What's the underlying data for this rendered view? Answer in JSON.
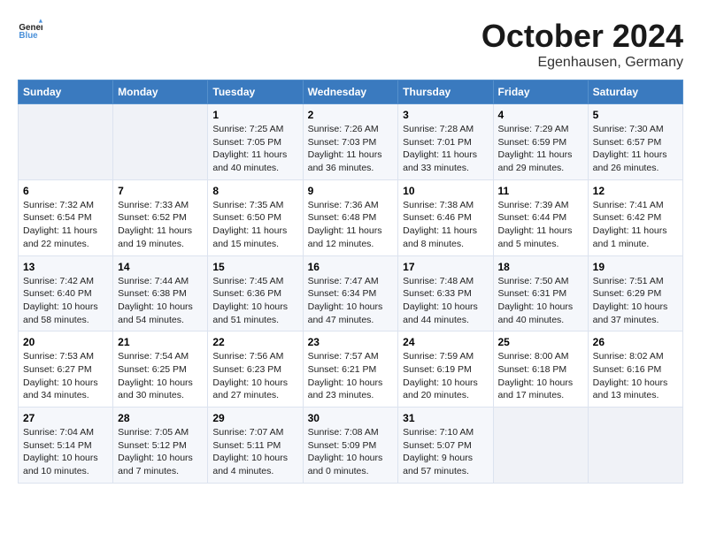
{
  "header": {
    "logo_text_general": "General",
    "logo_text_blue": "Blue",
    "month_title": "October 2024",
    "location": "Egenhausen, Germany"
  },
  "weekdays": [
    "Sunday",
    "Monday",
    "Tuesday",
    "Wednesday",
    "Thursday",
    "Friday",
    "Saturday"
  ],
  "weeks": [
    [
      {
        "day": "",
        "empty": true
      },
      {
        "day": "",
        "empty": true
      },
      {
        "day": "1",
        "sunrise": "Sunrise: 7:25 AM",
        "sunset": "Sunset: 7:05 PM",
        "daylight": "Daylight: 11 hours and 40 minutes."
      },
      {
        "day": "2",
        "sunrise": "Sunrise: 7:26 AM",
        "sunset": "Sunset: 7:03 PM",
        "daylight": "Daylight: 11 hours and 36 minutes."
      },
      {
        "day": "3",
        "sunrise": "Sunrise: 7:28 AM",
        "sunset": "Sunset: 7:01 PM",
        "daylight": "Daylight: 11 hours and 33 minutes."
      },
      {
        "day": "4",
        "sunrise": "Sunrise: 7:29 AM",
        "sunset": "Sunset: 6:59 PM",
        "daylight": "Daylight: 11 hours and 29 minutes."
      },
      {
        "day": "5",
        "sunrise": "Sunrise: 7:30 AM",
        "sunset": "Sunset: 6:57 PM",
        "daylight": "Daylight: 11 hours and 26 minutes."
      }
    ],
    [
      {
        "day": "6",
        "sunrise": "Sunrise: 7:32 AM",
        "sunset": "Sunset: 6:54 PM",
        "daylight": "Daylight: 11 hours and 22 minutes."
      },
      {
        "day": "7",
        "sunrise": "Sunrise: 7:33 AM",
        "sunset": "Sunset: 6:52 PM",
        "daylight": "Daylight: 11 hours and 19 minutes."
      },
      {
        "day": "8",
        "sunrise": "Sunrise: 7:35 AM",
        "sunset": "Sunset: 6:50 PM",
        "daylight": "Daylight: 11 hours and 15 minutes."
      },
      {
        "day": "9",
        "sunrise": "Sunrise: 7:36 AM",
        "sunset": "Sunset: 6:48 PM",
        "daylight": "Daylight: 11 hours and 12 minutes."
      },
      {
        "day": "10",
        "sunrise": "Sunrise: 7:38 AM",
        "sunset": "Sunset: 6:46 PM",
        "daylight": "Daylight: 11 hours and 8 minutes."
      },
      {
        "day": "11",
        "sunrise": "Sunrise: 7:39 AM",
        "sunset": "Sunset: 6:44 PM",
        "daylight": "Daylight: 11 hours and 5 minutes."
      },
      {
        "day": "12",
        "sunrise": "Sunrise: 7:41 AM",
        "sunset": "Sunset: 6:42 PM",
        "daylight": "Daylight: 11 hours and 1 minute."
      }
    ],
    [
      {
        "day": "13",
        "sunrise": "Sunrise: 7:42 AM",
        "sunset": "Sunset: 6:40 PM",
        "daylight": "Daylight: 10 hours and 58 minutes."
      },
      {
        "day": "14",
        "sunrise": "Sunrise: 7:44 AM",
        "sunset": "Sunset: 6:38 PM",
        "daylight": "Daylight: 10 hours and 54 minutes."
      },
      {
        "day": "15",
        "sunrise": "Sunrise: 7:45 AM",
        "sunset": "Sunset: 6:36 PM",
        "daylight": "Daylight: 10 hours and 51 minutes."
      },
      {
        "day": "16",
        "sunrise": "Sunrise: 7:47 AM",
        "sunset": "Sunset: 6:34 PM",
        "daylight": "Daylight: 10 hours and 47 minutes."
      },
      {
        "day": "17",
        "sunrise": "Sunrise: 7:48 AM",
        "sunset": "Sunset: 6:33 PM",
        "daylight": "Daylight: 10 hours and 44 minutes."
      },
      {
        "day": "18",
        "sunrise": "Sunrise: 7:50 AM",
        "sunset": "Sunset: 6:31 PM",
        "daylight": "Daylight: 10 hours and 40 minutes."
      },
      {
        "day": "19",
        "sunrise": "Sunrise: 7:51 AM",
        "sunset": "Sunset: 6:29 PM",
        "daylight": "Daylight: 10 hours and 37 minutes."
      }
    ],
    [
      {
        "day": "20",
        "sunrise": "Sunrise: 7:53 AM",
        "sunset": "Sunset: 6:27 PM",
        "daylight": "Daylight: 10 hours and 34 minutes."
      },
      {
        "day": "21",
        "sunrise": "Sunrise: 7:54 AM",
        "sunset": "Sunset: 6:25 PM",
        "daylight": "Daylight: 10 hours and 30 minutes."
      },
      {
        "day": "22",
        "sunrise": "Sunrise: 7:56 AM",
        "sunset": "Sunset: 6:23 PM",
        "daylight": "Daylight: 10 hours and 27 minutes."
      },
      {
        "day": "23",
        "sunrise": "Sunrise: 7:57 AM",
        "sunset": "Sunset: 6:21 PM",
        "daylight": "Daylight: 10 hours and 23 minutes."
      },
      {
        "day": "24",
        "sunrise": "Sunrise: 7:59 AM",
        "sunset": "Sunset: 6:19 PM",
        "daylight": "Daylight: 10 hours and 20 minutes."
      },
      {
        "day": "25",
        "sunrise": "Sunrise: 8:00 AM",
        "sunset": "Sunset: 6:18 PM",
        "daylight": "Daylight: 10 hours and 17 minutes."
      },
      {
        "day": "26",
        "sunrise": "Sunrise: 8:02 AM",
        "sunset": "Sunset: 6:16 PM",
        "daylight": "Daylight: 10 hours and 13 minutes."
      }
    ],
    [
      {
        "day": "27",
        "sunrise": "Sunrise: 7:04 AM",
        "sunset": "Sunset: 5:14 PM",
        "daylight": "Daylight: 10 hours and 10 minutes."
      },
      {
        "day": "28",
        "sunrise": "Sunrise: 7:05 AM",
        "sunset": "Sunset: 5:12 PM",
        "daylight": "Daylight: 10 hours and 7 minutes."
      },
      {
        "day": "29",
        "sunrise": "Sunrise: 7:07 AM",
        "sunset": "Sunset: 5:11 PM",
        "daylight": "Daylight: 10 hours and 4 minutes."
      },
      {
        "day": "30",
        "sunrise": "Sunrise: 7:08 AM",
        "sunset": "Sunset: 5:09 PM",
        "daylight": "Daylight: 10 hours and 0 minutes."
      },
      {
        "day": "31",
        "sunrise": "Sunrise: 7:10 AM",
        "sunset": "Sunset: 5:07 PM",
        "daylight": "Daylight: 9 hours and 57 minutes."
      },
      {
        "day": "",
        "empty": true
      },
      {
        "day": "",
        "empty": true
      }
    ]
  ]
}
